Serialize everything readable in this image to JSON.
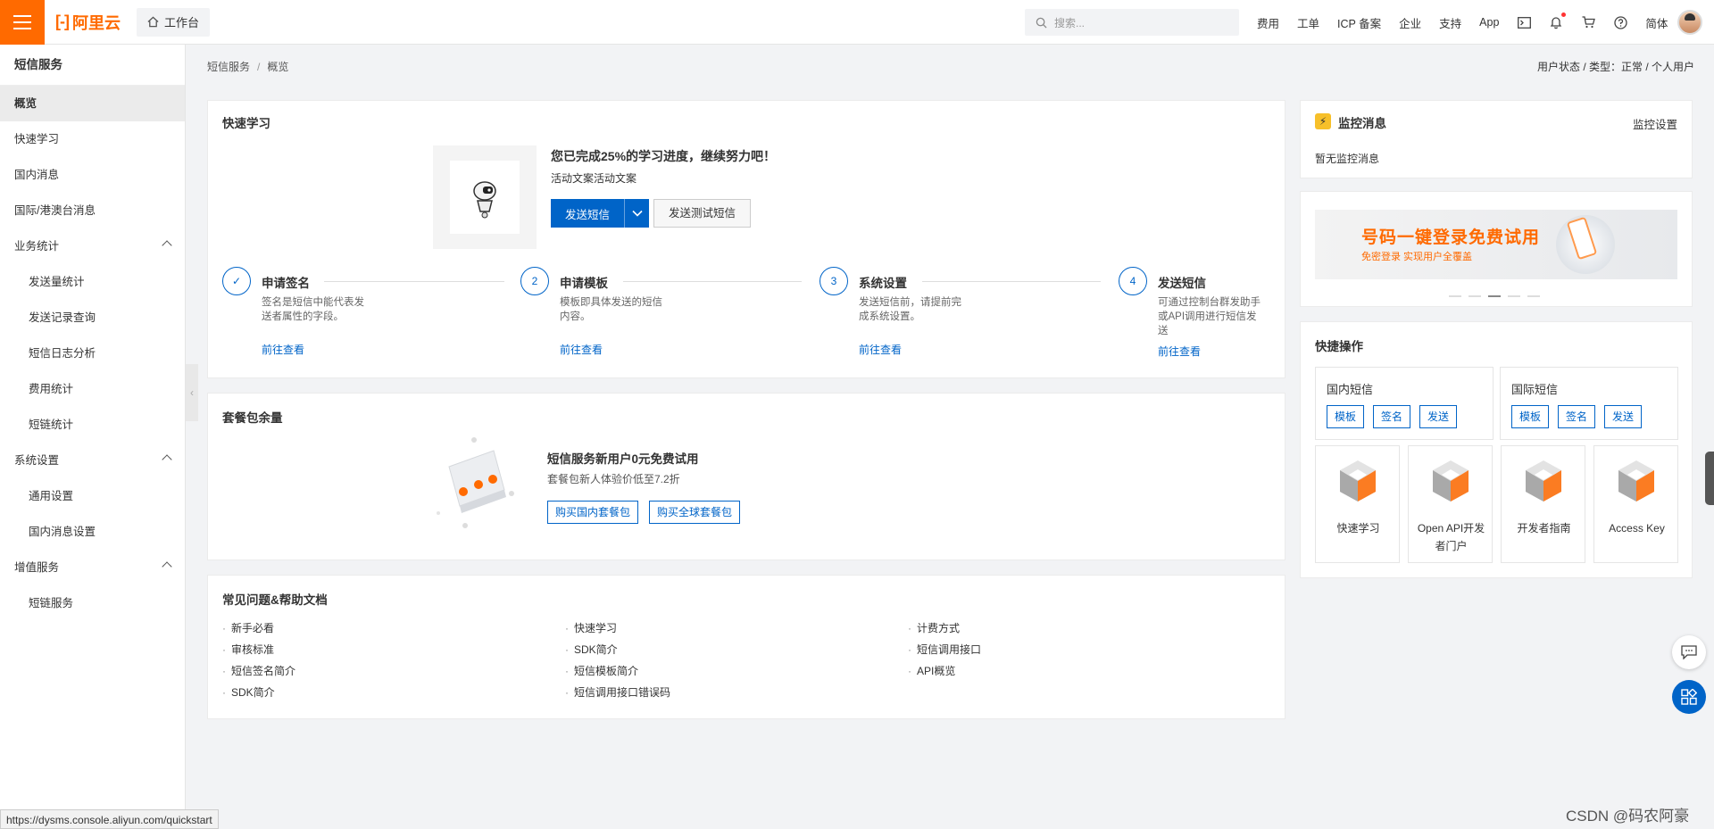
{
  "topbar": {
    "brand": "阿里云",
    "workbench": "工作台",
    "search_placeholder": "搜索...",
    "links": [
      "费用",
      "工单",
      "ICP 备案",
      "企业",
      "支持",
      "App"
    ],
    "lang": "简体",
    "icons": [
      "terminal-icon",
      "bell-icon",
      "cart-icon",
      "help-icon"
    ]
  },
  "sidebar": {
    "title": "短信服务",
    "items": [
      {
        "label": "概览",
        "type": "active"
      },
      {
        "label": "快速学习",
        "type": "top"
      },
      {
        "label": "国内消息",
        "type": "top"
      },
      {
        "label": "国际/港澳台消息",
        "type": "top"
      },
      {
        "label": "业务统计",
        "type": "group"
      },
      {
        "label": "发送量统计",
        "type": "sub"
      },
      {
        "label": "发送记录查询",
        "type": "sub"
      },
      {
        "label": "短信日志分析",
        "type": "sub"
      },
      {
        "label": "费用统计",
        "type": "sub"
      },
      {
        "label": "短链统计",
        "type": "sub"
      },
      {
        "label": "系统设置",
        "type": "group"
      },
      {
        "label": "通用设置",
        "type": "sub"
      },
      {
        "label": "国内消息设置",
        "type": "sub"
      },
      {
        "label": "增值服务",
        "type": "group"
      },
      {
        "label": "短链服务",
        "type": "sub"
      }
    ]
  },
  "breadcrumb": {
    "root": "短信服务",
    "sep": "/",
    "current": "概览"
  },
  "user_status": "用户状态 / 类型：正常 / 个人用户",
  "quick_learn": {
    "title": "快速学习",
    "progress_title": "您已完成25%的学习进度，继续努力吧！",
    "progress_sub": "活动文案活动文案",
    "primary_btn": "发送短信",
    "secondary_btn": "发送测试短信",
    "steps": [
      {
        "mark": "✓",
        "title": "申请签名",
        "desc": "签名是短信中能代表发送者属性的字段。",
        "link": "前往查看"
      },
      {
        "mark": "2",
        "title": "申请模板",
        "desc": "模板即具体发送的短信内容。",
        "link": "前往查看"
      },
      {
        "mark": "3",
        "title": "系统设置",
        "desc": "发送短信前，请提前完成系统设置。",
        "link": "前往查看"
      },
      {
        "mark": "4",
        "title": "发送短信",
        "desc": "可通过控制台群发助手或API调用进行短信发送",
        "link": "前往查看"
      }
    ]
  },
  "package": {
    "title": "套餐包余量",
    "promo_title": "短信服务新用户0元免费试用",
    "promo_sub": "套餐包新人体验价低至7.2折",
    "btn_domestic": "购买国内套餐包",
    "btn_global": "购买全球套餐包"
  },
  "faq": {
    "title": "常见问题&帮助文档",
    "items": [
      "新手必看",
      "快速学习",
      "计费方式",
      "审核标准",
      "SDK简介",
      "短信调用接口",
      "短信签名简介",
      "短信模板简介",
      "API概览",
      "SDK简介",
      "短信调用接口错误码"
    ]
  },
  "monitor": {
    "title": "监控消息",
    "settings": "监控设置",
    "empty": "暂无监控消息"
  },
  "banner": {
    "title": "号码一键登录免费试用",
    "sub": "免密登录 实现用户全覆盖",
    "active_dot": 2
  },
  "quick_ops": {
    "title": "快捷操作",
    "domestic": {
      "title": "国内短信",
      "buttons": [
        "模板",
        "签名",
        "发送"
      ]
    },
    "international": {
      "title": "国际短信",
      "buttons": [
        "模板",
        "签名",
        "发送"
      ]
    },
    "tiles": [
      "快速学习",
      "Open API开发者门户",
      "开发者指南",
      "Access Key"
    ]
  },
  "status_url": "https://dysms.console.aliyun.com/quickstart",
  "watermark": "CSDN @码农阿豪",
  "colors": {
    "brand": "#ff6a00",
    "primary": "#0064c8"
  }
}
